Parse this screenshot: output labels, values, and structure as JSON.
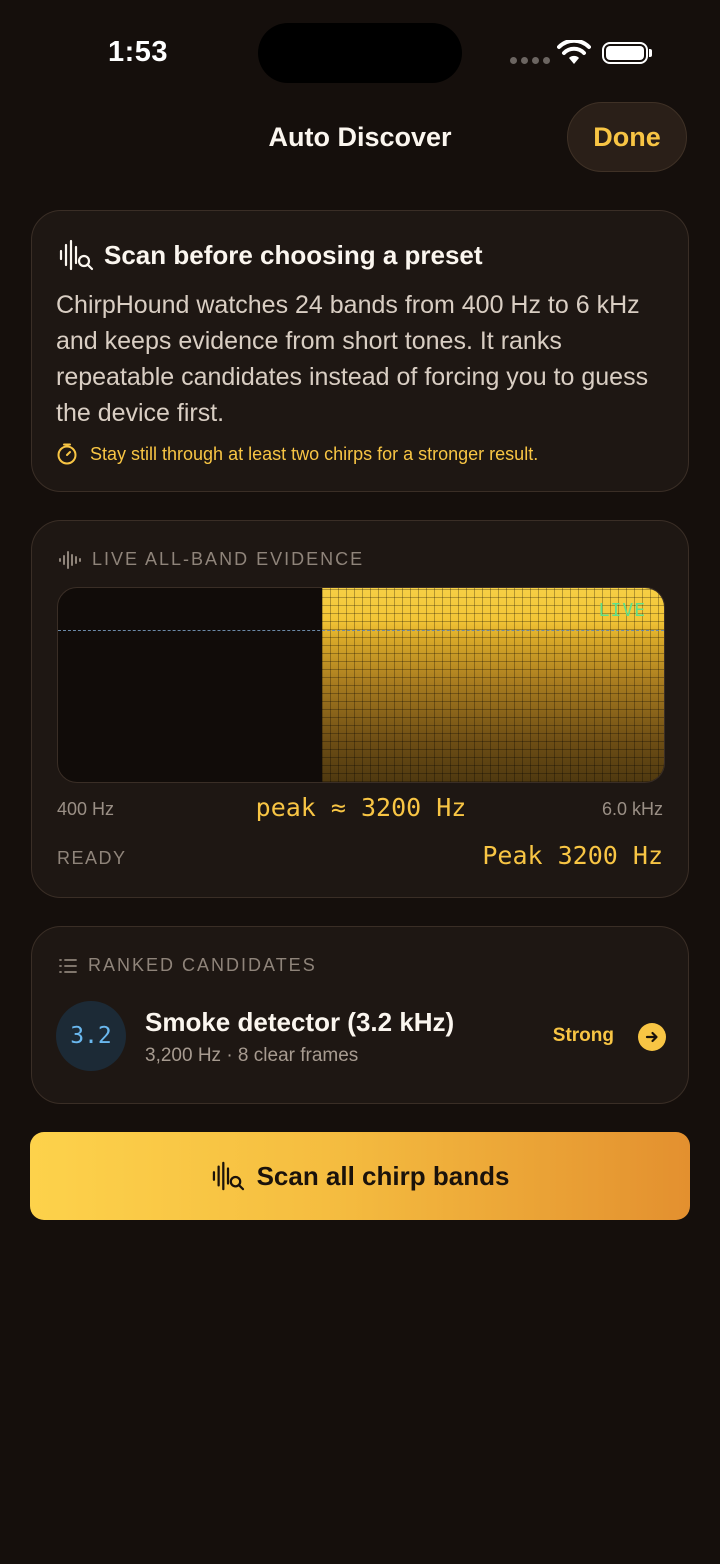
{
  "status_bar": {
    "time": "1:53"
  },
  "nav": {
    "title": "Auto Discover",
    "done_label": "Done"
  },
  "intro_card": {
    "title": "Scan before choosing a preset",
    "body": "ChirpHound watches 24 bands from 400 Hz to 6 kHz and keeps evidence from short tones. It ranks repeatable candidates instead of forcing you to guess the device first.",
    "tip": "Stay still through at least two chirps for a stronger result."
  },
  "evidence_card": {
    "section_label": "LIVE ALL-BAND EVIDENCE",
    "live_tag": "LIVE",
    "axis_min_label": "400 Hz",
    "axis_max_label": "6.0 kHz",
    "peak_estimate": "peak ≈ 3200 Hz",
    "state": "READY",
    "peak_readout": "Peak 3200 Hz",
    "active_fraction_start": 0.435
  },
  "candidates_card": {
    "section_label": "RANKED CANDIDATES",
    "items": [
      {
        "badge": "3.2",
        "title": "Smoke detector (3.2 kHz)",
        "subtitle": "3,200 Hz · 8 clear frames",
        "strength": "Strong"
      }
    ]
  },
  "scan_button": {
    "label": "Scan all chirp bands"
  },
  "colors": {
    "background": "#150f0c",
    "accent": "#f8c544",
    "live_green": "#5fe08a",
    "badge_blue": "#6ab8ef"
  }
}
